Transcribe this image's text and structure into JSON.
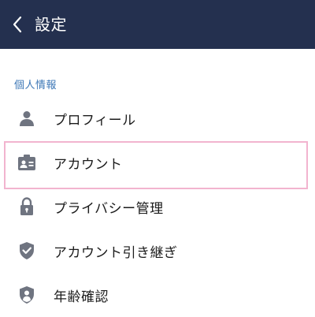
{
  "header": {
    "title": "設定"
  },
  "section": {
    "title": "個人情報"
  },
  "items": [
    {
      "label": "プロフィール",
      "icon": "person-icon"
    },
    {
      "label": "アカウント",
      "icon": "id-card-icon"
    },
    {
      "label": "プライバシー管理",
      "icon": "lock-icon"
    },
    {
      "label": "アカウント引き継ぎ",
      "icon": "shield-check-icon"
    },
    {
      "label": "年齢確認",
      "icon": "shield-person-icon"
    }
  ],
  "colors": {
    "header_bg": "#24304f",
    "section_title": "#3d77b6",
    "icon_gray": "#6f7480",
    "highlight_border": "#f2b4cf"
  }
}
